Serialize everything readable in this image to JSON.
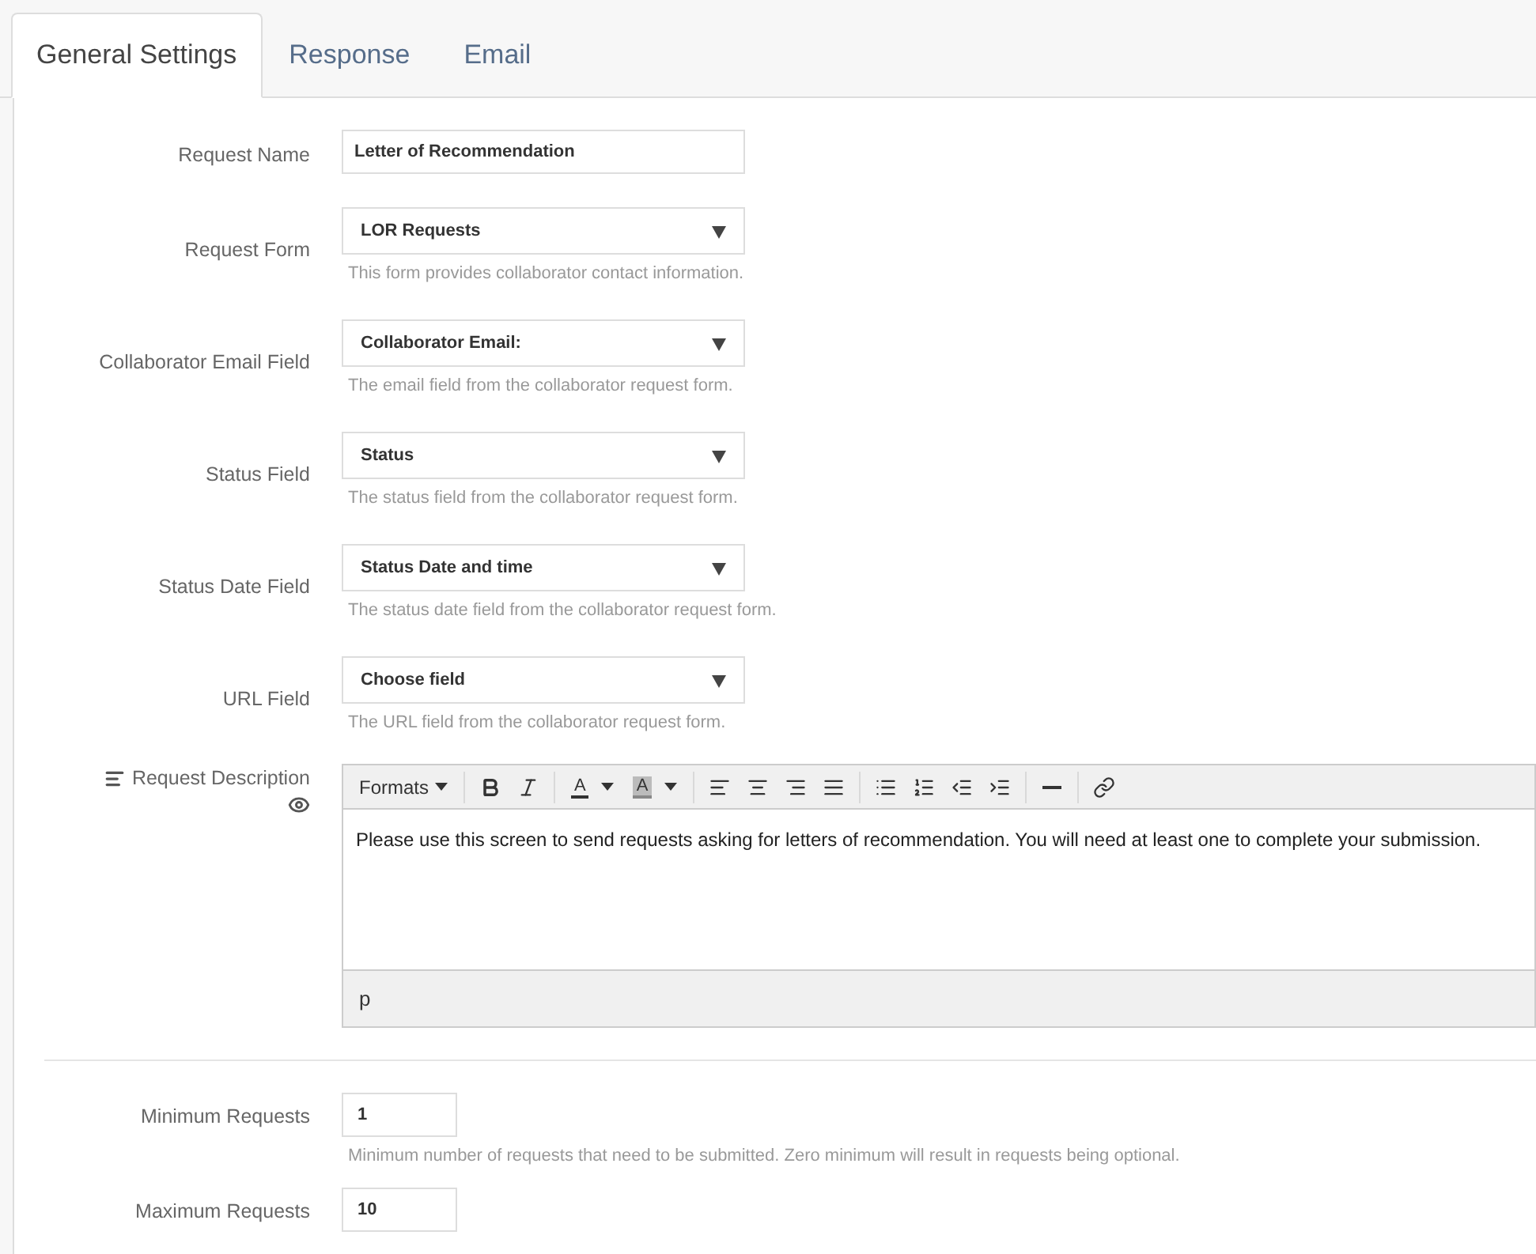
{
  "tabs": [
    {
      "label": "General Settings",
      "selected": true
    },
    {
      "label": "Response",
      "selected": false
    },
    {
      "label": "Email",
      "selected": false
    }
  ],
  "fields": [
    {
      "kind": "text",
      "label": "Request Name",
      "value": "Letter of Recommendation"
    },
    {
      "kind": "select",
      "label": "Request Form",
      "value": "LOR Requests",
      "help": "This form provides collaborator contact information."
    },
    {
      "kind": "select",
      "label": "Collaborator Email Field",
      "value": "Collaborator Email:",
      "help": "The email field from the collaborator request form."
    },
    {
      "kind": "select",
      "label": "Status Field",
      "value": "Status",
      "help": "The status field from the collaborator request form."
    },
    {
      "kind": "select",
      "label": "Status Date Field",
      "value": "Status Date and time",
      "help": "The status date field from the collaborator request form."
    },
    {
      "kind": "select",
      "label": "URL Field",
      "value": "Choose field",
      "help": "The URL field from the collaborator request form."
    }
  ],
  "editor": {
    "label": "Request Description",
    "toolbar": [
      {
        "kind": "formats",
        "label": "Formats"
      },
      {
        "kind": "sep"
      },
      {
        "kind": "bold"
      },
      {
        "kind": "italic"
      },
      {
        "kind": "sep"
      },
      {
        "kind": "text_color",
        "label": "A"
      },
      {
        "kind": "bg_color",
        "label": "A"
      },
      {
        "kind": "sep"
      },
      {
        "kind": "align_left"
      },
      {
        "kind": "align_center"
      },
      {
        "kind": "align_right"
      },
      {
        "kind": "align_justify"
      },
      {
        "kind": "sep"
      },
      {
        "kind": "bullets"
      },
      {
        "kind": "numbers"
      },
      {
        "kind": "outdent"
      },
      {
        "kind": "indent"
      },
      {
        "kind": "sep"
      },
      {
        "kind": "rule"
      },
      {
        "kind": "sep"
      },
      {
        "kind": "link"
      }
    ],
    "content": "Please use this screen to send requests asking for letters of recommendation. You will need at least one to complete your submission.",
    "path": "p"
  },
  "limits": [
    {
      "label": "Minimum Requests",
      "value": "1",
      "help": "Minimum number of requests that need to be submitted. Zero minimum will result in requests being optional."
    },
    {
      "label": "Maximum Requests",
      "value": "10"
    }
  ]
}
